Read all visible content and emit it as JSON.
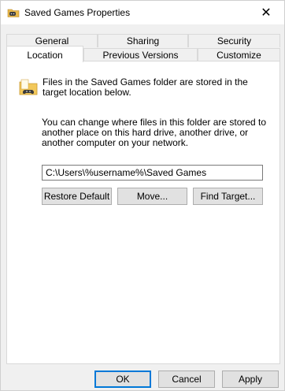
{
  "window": {
    "title": "Saved Games Properties",
    "close_glyph": "✕"
  },
  "tabs": {
    "row1": [
      "General",
      "Sharing",
      "Security"
    ],
    "row2": [
      "Location",
      "Previous Versions",
      "Customize"
    ],
    "active": "Location"
  },
  "location": {
    "description1": "Files in the Saved Games folder are stored in the target location below.",
    "description2": "You can change where files in this folder are stored to another place on this hard drive, another drive, or another computer on your network.",
    "path_value": "C:\\Users\\%username%\\Saved Games",
    "buttons": {
      "restore_default": "Restore Default",
      "move": "Move...",
      "find_target": "Find Target..."
    }
  },
  "footer": {
    "ok": "OK",
    "cancel": "Cancel",
    "apply": "Apply"
  },
  "icons": {
    "title": "folder-gamepad-icon",
    "folder": "saved-games-folder-icon",
    "close": "close-icon"
  },
  "colors": {
    "accent": "#0078d7",
    "button_bg": "#e1e1e1",
    "panel_bg": "#ffffff",
    "window_bg": "#f0f0f0"
  }
}
